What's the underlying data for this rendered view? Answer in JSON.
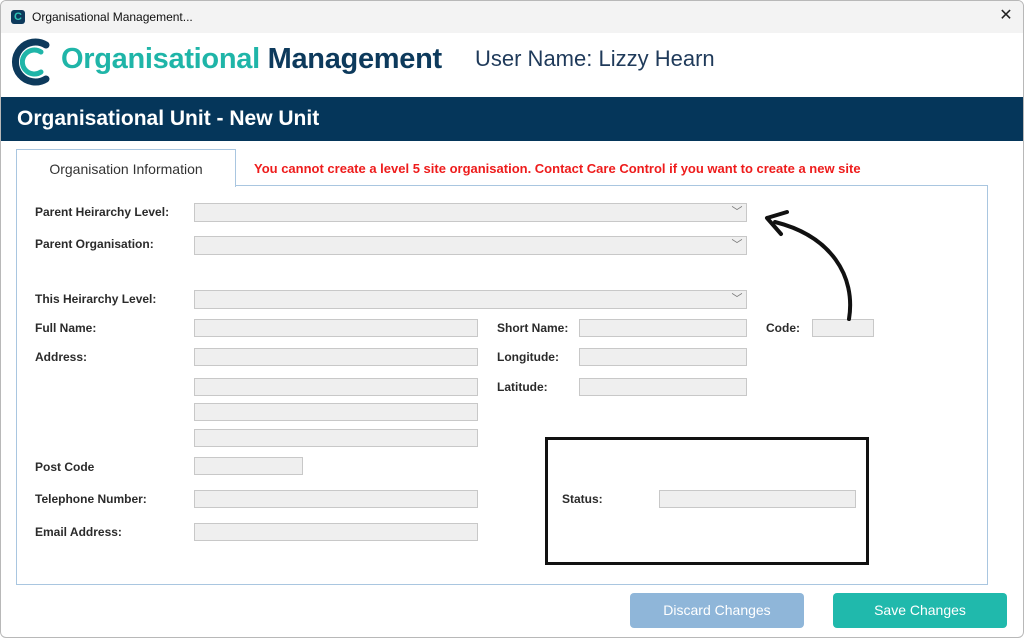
{
  "window": {
    "title": "Organisational Management..."
  },
  "app": {
    "name_part1": "Organisational",
    "name_part2": "Management",
    "user_label": "User Name: Lizzy Hearn",
    "logo_letter": "C"
  },
  "page": {
    "title": "Organisational Unit - New Unit"
  },
  "tab": {
    "label": "Organisation Information"
  },
  "warning": "You cannot create a level 5 site organisation.  Contact Care Control if you want to create a new site",
  "form": {
    "parent_hierarchy_level": "Parent Heirarchy Level:",
    "parent_organisation": "Parent Organisation:",
    "this_hierarchy_level": "This Heirarchy Level:",
    "full_name": "Full Name:",
    "short_name": "Short Name:",
    "code": "Code:",
    "address": "Address:",
    "longitude": "Longitude:",
    "latitude": "Latitude:",
    "post_code": "Post Code",
    "telephone": "Telephone Number:",
    "email": "Email Address:",
    "status": "Status:"
  },
  "buttons": {
    "discard": "Discard Changes",
    "save": "Save Changes"
  },
  "icons": {
    "dropdown": "chevron-down-icon",
    "close": "close-icon",
    "arrow": "curved-arrow-icon"
  },
  "colors": {
    "brand_navy": "#05365a",
    "brand_teal": "#1fb5a8",
    "warning_red": "#ee1c1c",
    "discard_blue": "#8fb6d9",
    "save_teal": "#20b9ac"
  }
}
